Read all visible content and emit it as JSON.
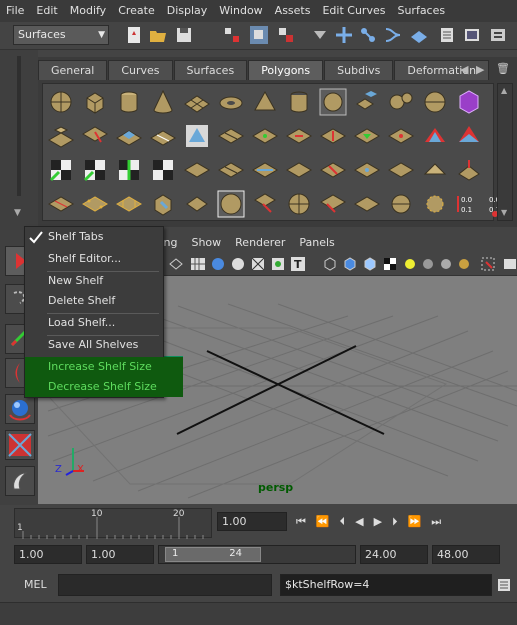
{
  "menubar": {
    "items": [
      "File",
      "Edit",
      "Modify",
      "Create",
      "Display",
      "Window",
      "Assets",
      "Edit Curves",
      "Surfaces"
    ]
  },
  "statusline": {
    "mode": "Surfaces"
  },
  "shelf": {
    "tabs": [
      "General",
      "Curves",
      "Surfaces",
      "Polygons",
      "Subdivs",
      "Deformation"
    ],
    "active_tab": "Polygons"
  },
  "panel": {
    "menu": [
      "Lighting",
      "Show",
      "Renderer",
      "Panels"
    ],
    "camera_label": "persp",
    "axis_z": "Z",
    "axis_x": "X"
  },
  "context_menu": {
    "items": [
      {
        "label": "Shelf Tabs",
        "checked": true
      },
      {
        "label": "Shelf Editor..."
      },
      {
        "label": "New Shelf"
      },
      {
        "label": "Delete Shelf"
      },
      {
        "label": "Load Shelf..."
      },
      {
        "label": "Save All Shelves"
      },
      {
        "label": "Increase Shelf Size",
        "highlight": true
      },
      {
        "label": "Decrease Shelf Size",
        "highlight": true
      }
    ]
  },
  "timeslider": {
    "tick_1": "1",
    "tick_10": "10",
    "tick_20": "20",
    "current_frame": "1.00"
  },
  "range": {
    "anim_start": "1.00",
    "play_start": "1.00",
    "range_start": "1",
    "range_end": "24",
    "play_end": "24.00",
    "anim_end": "48.00"
  },
  "command": {
    "label": "MEL",
    "result": "$ktShelfRow=4"
  },
  "colors": {
    "highlight": "#0f5a0f",
    "highlight_text": "#5edc5e",
    "viewport_bg": "#7f7f7f",
    "shelf_icon_tan": "#b19a63"
  }
}
